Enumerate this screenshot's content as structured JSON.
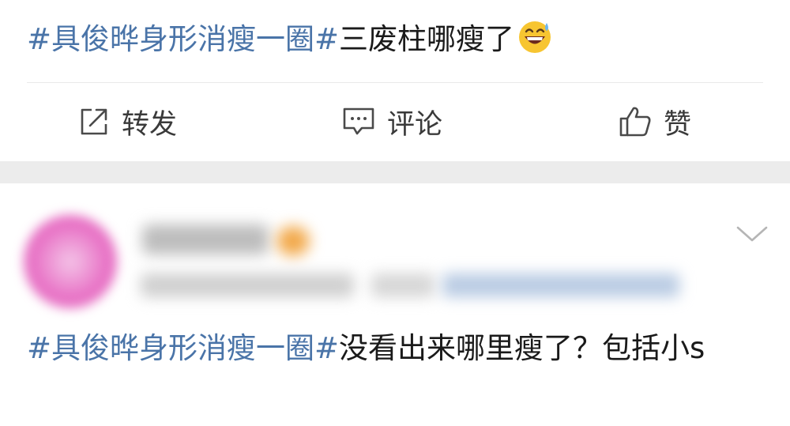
{
  "post": {
    "topic": "#具俊晔身形消瘦一圈#",
    "text": "三废柱哪瘦了",
    "emoji": "grinning-sweat-emoji"
  },
  "actions": {
    "repost": {
      "icon": "share-box-icon",
      "label": "转发"
    },
    "comment": {
      "icon": "comment-bubble-icon",
      "label": "评论"
    },
    "like": {
      "icon": "thumbs-up-icon",
      "label": "赞"
    }
  },
  "comment": {
    "topic": "#具俊晔身形消瘦一圈#",
    "text": "没看出来哪里瘦了？包括小s",
    "menu_icon": "chevron-down-icon"
  },
  "colors": {
    "topic_link": "#4a74a8",
    "text": "#1a1a1a",
    "separator_band": "#ececec"
  }
}
